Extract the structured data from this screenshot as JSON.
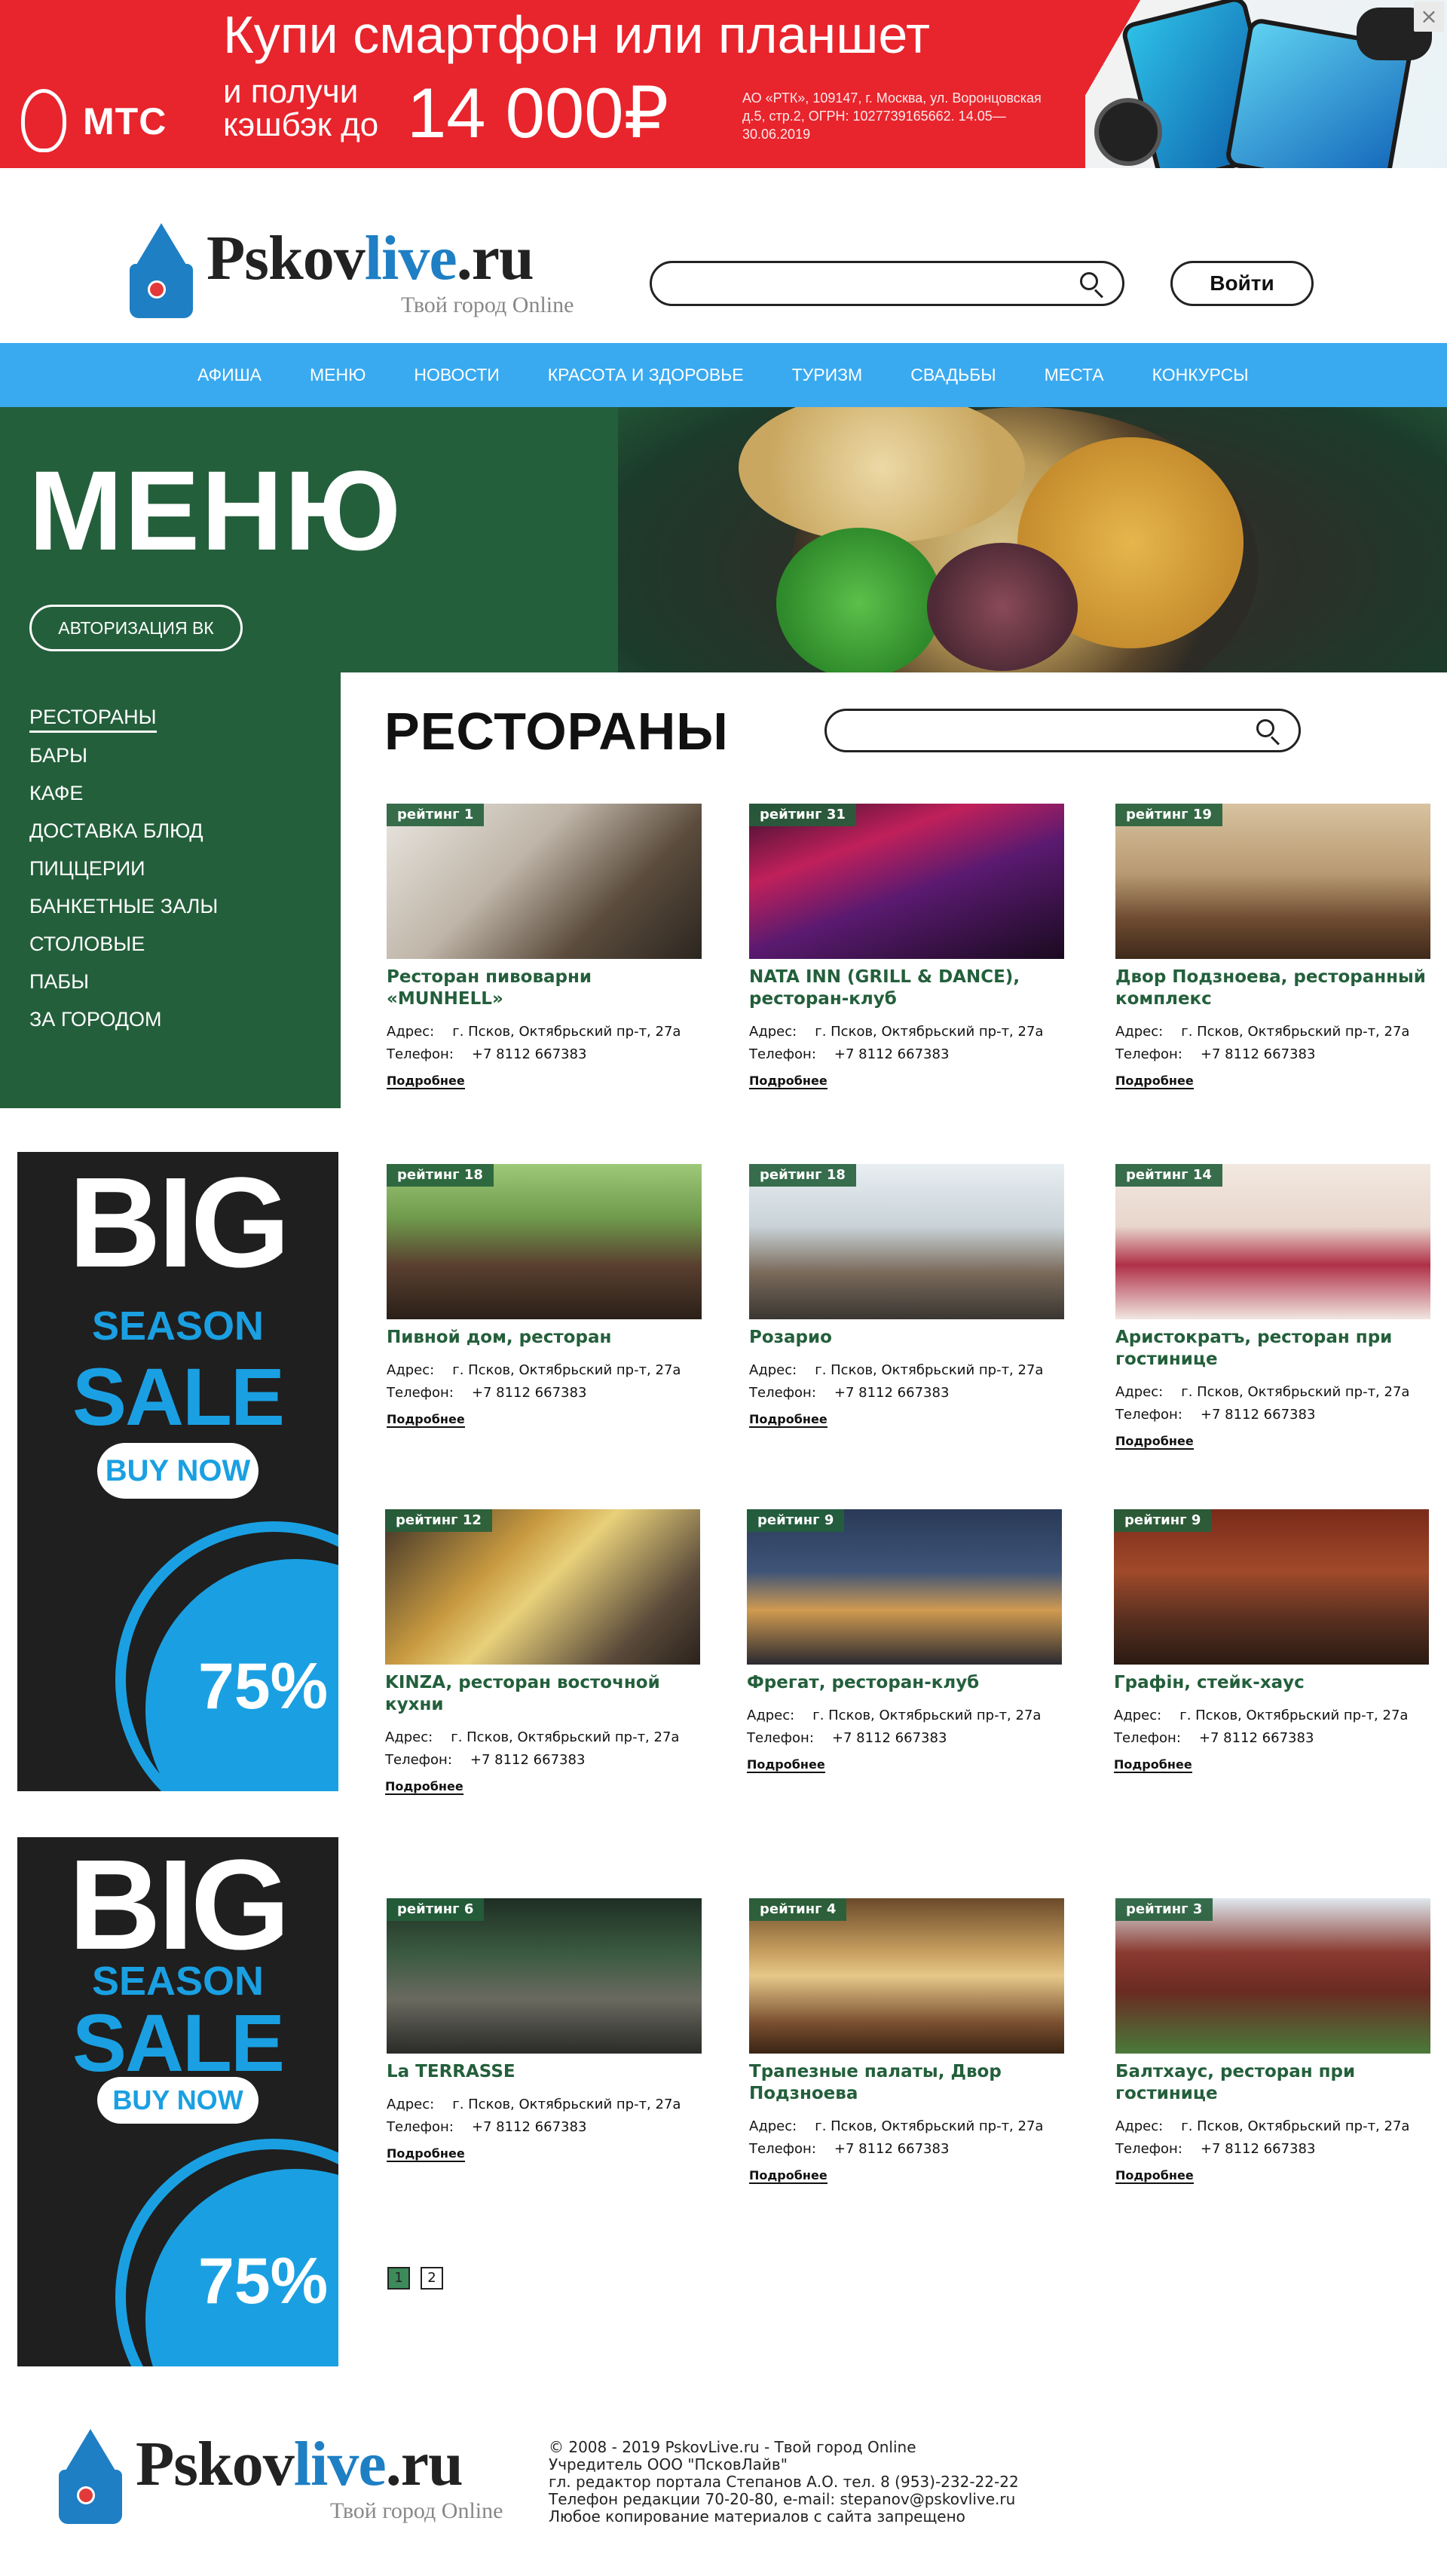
{
  "top_banner": {
    "brand": "МТС",
    "headline": "Купи смартфон или планшет",
    "sub_line1": "и получи",
    "sub_line2": "кэшбэк до",
    "amount": "14 000₽",
    "legal": "АО «РТК», 109147, г. Москва, ул. Воронцовская д.5, стр.2, ОГРН: 1027739165662. 14.05—30.06.2019",
    "close": "×"
  },
  "header": {
    "logo_part1": "Pskov",
    "logo_part2": "live",
    "logo_part3": ".ru",
    "logo_tagline": "Твой город Online",
    "search_placeholder": "",
    "login_label": "Войти"
  },
  "nav": [
    "АФИША",
    "МЕНЮ",
    "НОВОСТИ",
    "КРАСОТА И ЗДОРОВЬЕ",
    "ТУРИЗМ",
    "СВАДЬБЫ",
    "МЕСТА",
    "КОНКУРСЫ"
  ],
  "hero": {
    "title": "МЕНЮ",
    "vk_button": "АВТОРИЗАЦИЯ ВК"
  },
  "side_menu": {
    "items": [
      "РЕСТОРАНЫ",
      "БАРЫ",
      "КАФЕ",
      "ДОСТАВКА БЛЮД",
      "ПИЦЦЕРИИ",
      "БАНКЕТНЫЕ ЗАЛЫ",
      "СТОЛОВЫЕ",
      "ПАБЫ",
      "ЗА ГОРОДОМ"
    ],
    "active": "РЕСТОРАНЫ"
  },
  "ads": [
    {
      "big": "BIG",
      "season": "SEASON",
      "sale": "SALE",
      "buy": "BUY NOW",
      "percent": "75%"
    },
    {
      "big": "BIG",
      "season": "SEASON",
      "sale": "SALE",
      "buy": "BUY NOW",
      "percent": "75%"
    }
  ],
  "content": {
    "title": "РЕСТОРАНЫ",
    "address_label": "Адрес:",
    "phone_label": "Телефон:",
    "more_label": "Подробнее",
    "cards": [
      {
        "rating": "рейтинг  1",
        "name": "Ресторан пивоварни «MUNHELL»",
        "address": "г. Псков, Октябрьский пр-т, 27а",
        "phone": "+7 8112 667383"
      },
      {
        "rating": "рейтинг  31",
        "name": "NATA INN (GRILL & DANCE), ресторан-клуб",
        "address": "г. Псков, Октябрьский пр-т, 27а",
        "phone": "+7 8112 667383"
      },
      {
        "rating": "рейтинг  19",
        "name": "Двор Подзноева, ресторанный комплекс",
        "address": "г. Псков, Октябрьский пр-т, 27а",
        "phone": "+7 8112 667383"
      },
      {
        "rating": "рейтинг  18",
        "name": "Пивной дом, ресторан",
        "address": "г. Псков, Октябрьский пр-т, 27а",
        "phone": "+7 8112 667383"
      },
      {
        "rating": "рейтинг  18",
        "name": "Розарио",
        "address": "г. Псков, Октябрьский пр-т, 27а",
        "phone": "+7 8112 667383"
      },
      {
        "rating": "рейтинг  14",
        "name": "Аристократъ, ресторан при гостинице",
        "address": "г. Псков, Октябрьский пр-т, 27а",
        "phone": "+7 8112 667383"
      },
      {
        "rating": "рейтинг  12",
        "name": "KINZA, ресторан восточной кухни",
        "address": "г. Псков, Октябрьский пр-т, 27а",
        "phone": "+7 8112 667383"
      },
      {
        "rating": "рейтинг  9",
        "name": "Фрегат, ресторан-клуб",
        "address": "г. Псков, Октябрьский пр-т, 27а",
        "phone": "+7 8112 667383"
      },
      {
        "rating": "рейтинг  9",
        "name": "Графiн, стейк-хаус",
        "address": "г. Псков, Октябрьский пр-т, 27а",
        "phone": "+7 8112 667383"
      },
      {
        "rating": "рейтинг  6",
        "name": "La TERRASSE",
        "address": "г. Псков, Октябрьский пр-т, 27а",
        "phone": "+7 8112 667383"
      },
      {
        "rating": "рейтинг  4",
        "name": "Трапезные палаты, Двор Подзноева",
        "address": "г. Псков, Октябрьский пр-т, 27а",
        "phone": "+7 8112 667383"
      },
      {
        "rating": "рейтинг  3",
        "name": "Балтхаус, ресторан при гостинице",
        "address": "г. Псков, Октябрьский пр-т, 27а",
        "phone": "+7 8112 667383"
      }
    ]
  },
  "pagination": [
    "1",
    "2"
  ],
  "footer": {
    "lines": [
      "© 2008 - 2019 PskovLive.ru - Твой город Online",
      "Учредитель ООО \"ПсковЛайв\"",
      "гл. редактор портала Степанов А.О. тел. 8 (953)-232-22-22",
      "Телефон редакции 70-20-80, e-mail: stepanov@pskovlive.ru",
      "Любое копирование материалов с сайта запрещено"
    ]
  },
  "colors": {
    "nav": "#3aaaf0",
    "green": "#235f3b",
    "banner_red": "#e8242c",
    "ad_blue": "#1aa0e2"
  }
}
